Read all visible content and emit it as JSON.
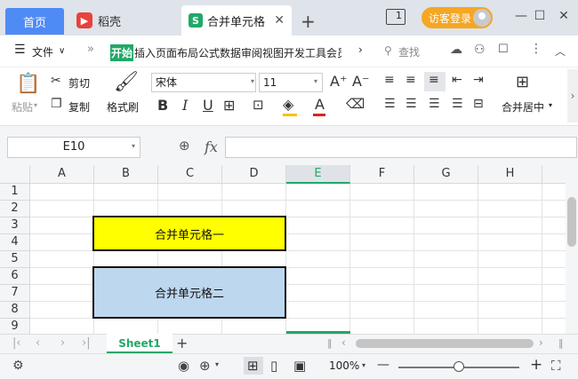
{
  "titlebar": {
    "tabs": [
      {
        "label": "首页",
        "active": false
      },
      {
        "label": "稻壳",
        "active": false
      },
      {
        "label": "合并单元格",
        "active": true
      }
    ],
    "new_tab": "+",
    "page_indicator": "1",
    "guest_login": "访客登录",
    "brand_color": "#4f8bf5",
    "guest_color": "#f5a623"
  },
  "menubar": {
    "menu_icon": "hamburger-icon",
    "file": "文件",
    "more": "»",
    "start_tab": "开始",
    "ribbon_tabs": "插入页面布局公式数据审阅视图开发工具会员专",
    "search": "查找"
  },
  "toolbar": {
    "paste": "粘贴",
    "cut": "剪切",
    "copy": "复制",
    "format_painter": "格式刷",
    "font_name": "宋体",
    "font_size": "11",
    "bold": "B",
    "italic": "I",
    "underline": "U",
    "merge_center": "合并居中"
  },
  "formula_bar": {
    "cell_ref": "E10",
    "fx": "fx",
    "value": ""
  },
  "grid": {
    "columns": [
      "A",
      "B",
      "C",
      "D",
      "E",
      "F",
      "G",
      "H"
    ],
    "active_column": "E",
    "rows": [
      "1",
      "2",
      "3",
      "4",
      "5",
      "6",
      "7",
      "8",
      "9"
    ],
    "merged_cells": [
      {
        "text": "合并单元格一",
        "fill": "#ffff00"
      },
      {
        "text": "合并单元格二",
        "fill": "#bdd7ee"
      }
    ],
    "accent": "#21a868"
  },
  "sheets": {
    "tabs": [
      "Sheet1"
    ],
    "add": "+"
  },
  "statusbar": {
    "zoom": "100%",
    "zoom_minus": "—",
    "zoom_plus": "+"
  }
}
